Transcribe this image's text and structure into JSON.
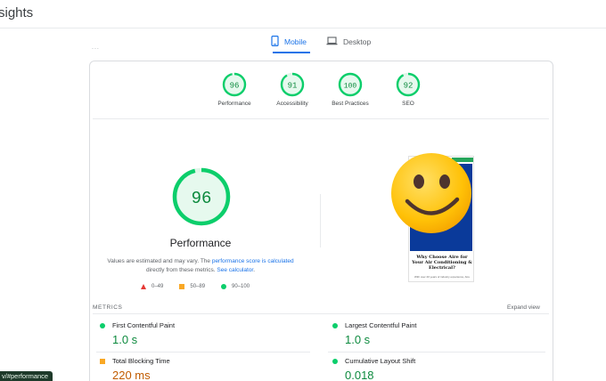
{
  "header": {
    "title": "sights"
  },
  "tabs": [
    {
      "label": "Mobile",
      "active": true,
      "icon": "phone-icon"
    },
    {
      "label": "Desktop",
      "active": false,
      "icon": "laptop-icon"
    }
  ],
  "more_indicator": "...",
  "categories": [
    {
      "score": 96,
      "label": "Performance"
    },
    {
      "score": 91,
      "label": "Accessibility"
    },
    {
      "score": 100,
      "label": "Best Practices"
    },
    {
      "score": 92,
      "label": "SEO"
    }
  ],
  "performance": {
    "score": 96,
    "title": "Performance",
    "desc_1": "Values are estimated and may vary. The ",
    "desc_link_1": "performance score is calculated",
    "desc_2": " directly from these metrics. ",
    "desc_link_2": "See calculator",
    "desc_3": "."
  },
  "legend": [
    {
      "range": "0–49",
      "shape": "triangle",
      "color": "#e53935"
    },
    {
      "range": "50–89",
      "shape": "square",
      "color": "#f9a825"
    },
    {
      "range": "90–100",
      "shape": "circle",
      "color": "#0cce6b"
    }
  ],
  "preview": {
    "heading": "Why Choose Aire for Your Air Conditioning & Electrical?",
    "subtext": "With over 20 years of industry experience, Aire"
  },
  "metrics": {
    "header": "METRICS",
    "expand_label": "Expand view",
    "items": [
      {
        "name": "First Contentful Paint",
        "value": "1.0 s",
        "status": "good"
      },
      {
        "name": "Largest Contentful Paint",
        "value": "1.0 s",
        "status": "good"
      },
      {
        "name": "Total Blocking Time",
        "value": "220 ms",
        "status": "average"
      },
      {
        "name": "Cumulative Layout Shift",
        "value": "0.018",
        "status": "good"
      }
    ]
  },
  "url_fragment": "v/#performance",
  "colors": {
    "good": "#0cce6b",
    "good_text": "#0d8a3e",
    "average": "#f9a825",
    "average_text": "#c15c00",
    "poor": "#e53935",
    "accent": "#1a73e8"
  }
}
